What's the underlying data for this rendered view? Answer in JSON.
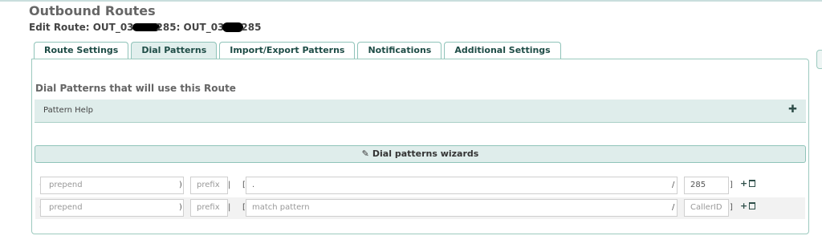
{
  "header": {
    "title": "Outbound Routes",
    "edit_prefix": "Edit Route: OUT_03",
    "edit_mid": "285: OUT_03",
    "edit_suffix": "285"
  },
  "tabs": [
    {
      "label": "Route Settings",
      "active": false
    },
    {
      "label": "Dial Patterns",
      "active": true
    },
    {
      "label": "Import/Export Patterns",
      "active": false
    },
    {
      "label": "Notifications",
      "active": false
    },
    {
      "label": "Additional Settings",
      "active": false
    }
  ],
  "dial_patterns": {
    "heading": "Dial Patterns that will use this Route",
    "help_label": "Pattern Help",
    "wizard_label": "Dial patterns wizards",
    "rows": [
      {
        "prepend_placeholder": "prepend",
        "prefix_placeholder": "prefix",
        "match_value": ".",
        "match_placeholder": "match pattern",
        "callerid_value": "285",
        "callerid_placeholder": "CallerID"
      },
      {
        "prepend_placeholder": "prepend",
        "prefix_placeholder": "prefix",
        "match_value": "",
        "match_placeholder": "match pattern",
        "callerid_value": "",
        "callerid_placeholder": "CallerID"
      }
    ],
    "symbols": {
      "open_paren": "(",
      "close_paren": ")",
      "pipe": "|",
      "open_bracket": "[",
      "slash": "/",
      "close_bracket": "]"
    },
    "add_icon": "+"
  },
  "colors": {
    "accent": "#8fc3b9",
    "panel_bg": "#dfedeb",
    "tab_text": "#1f4d47"
  },
  "icons": {
    "help_toggle": "plus-icon",
    "wizard": "magic-wand-icon",
    "row_add": "plus-icon",
    "row_delete": "trash-icon"
  }
}
